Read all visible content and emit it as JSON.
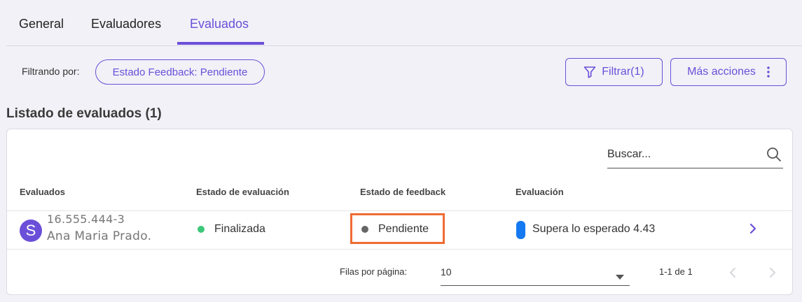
{
  "tabs": [
    {
      "label": "General"
    },
    {
      "label": "Evaluadores"
    },
    {
      "label": "Evaluados",
      "active": true
    }
  ],
  "filter": {
    "label": "Filtrando por:",
    "chip": "Estado Feedback: Pendiente"
  },
  "actions": {
    "filter_button": "Filtrar",
    "filter_count": "(1)",
    "more_button": "Más acciones"
  },
  "section": {
    "title": "Listado de evaluados (1)"
  },
  "search": {
    "placeholder": "Buscar..."
  },
  "table": {
    "columns": [
      "Evaluados",
      "Estado de evaluación",
      "Estado de feedback",
      "Evaluación"
    ],
    "rows": [
      {
        "avatar_letter": "S",
        "id": "16.555.444-3",
        "name": "Ana Maria Prado.",
        "evaluation_status": "Finalizada",
        "evaluation_status_color": "#3cc87a",
        "feedback_status": "Pendiente",
        "feedback_status_color": "#666666",
        "evaluation": "Supera lo esperado 4.43",
        "evaluation_color": "#1579f1"
      }
    ]
  },
  "pagination": {
    "rows_per_page_label": "Filas por página:",
    "rows_per_page": "10",
    "range": "1-1 de 1"
  },
  "colors": {
    "accent": "#6b4fd8",
    "highlight": "#ef6b33"
  },
  "icons": [
    "filter-icon",
    "more-vertical-icon",
    "search-icon",
    "chevron-right-icon",
    "chevron-down-icon",
    "chevron-left-icon"
  ]
}
